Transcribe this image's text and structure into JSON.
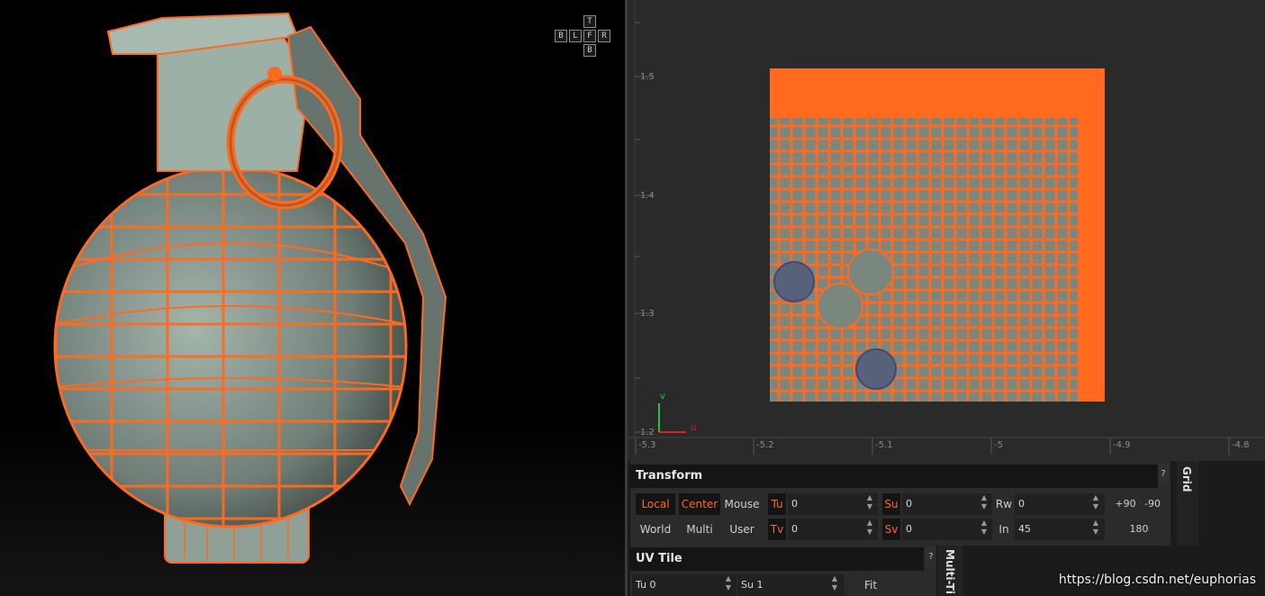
{
  "view_cube": {
    "top": "T",
    "bottom": "B",
    "left": "L",
    "front": "F",
    "right": "R",
    "back": "B"
  },
  "uv_view": {
    "y_ticks": [
      "1.5",
      "1.4",
      "1.3",
      "1.2"
    ],
    "x_ticks": [
      "-5.3",
      "-5.2",
      "-5.1",
      "-5",
      "-4.9",
      "-4.8"
    ],
    "axis_v": "v",
    "axis_u": "u"
  },
  "colors": {
    "wire": "#ff6a1f",
    "mesh": "#7e8f86",
    "accent": "#ff6a1f"
  },
  "transform": {
    "title": "Transform",
    "help": "?",
    "local": "Local",
    "center": "Center",
    "mouse": "Mouse",
    "world": "World",
    "multi": "Multi",
    "user": "User",
    "tu_label": "Tu",
    "tu_value": "0",
    "tv_label": "Tv",
    "tv_value": "0",
    "su_label": "Su",
    "su_value": "0",
    "sv_label": "Sv",
    "sv_value": "0",
    "rw_label": "Rw",
    "rw_value": "0",
    "in_label": "In",
    "in_value": "45",
    "plus90": "+90",
    "minus90": "-90",
    "r180": "180"
  },
  "grid_tab": "Grid",
  "uv_tile": {
    "title": "UV Tile",
    "help": "?",
    "tu_label": "Tu",
    "tu_value": "0",
    "su_label": "Su",
    "su_value": "1",
    "fit": "Fit"
  },
  "multi_tile_tab": "Multi-Ti",
  "watermark": "https://blog.csdn.net/euphorias"
}
